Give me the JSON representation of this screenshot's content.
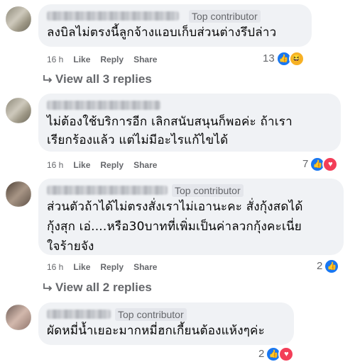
{
  "comments": [
    {
      "badge": "Top contributor",
      "text_lines": [
        "ลงบิลไม่ตรงนี้ลูกจ้างแอบเก็บส่วนต่างรึปล่าว"
      ],
      "time": "16 h",
      "like": "Like",
      "reply": "Reply",
      "share": "Share",
      "reaction_count": "13",
      "reactions": [
        "like-icon",
        "haha-icon"
      ]
    },
    {
      "badge": "",
      "text_lines": [
        "ไม่ต้องใช้บริการอีก เลิกสนับสนุนก็พอค่ะ ถ้าเรา",
        "เรียกร้องแล้ว แต่ไม่มีอะไรแก้ไขได้"
      ],
      "time": "16 h",
      "like": "Like",
      "reply": "Reply",
      "share": "Share",
      "reaction_count": "7",
      "reactions": [
        "like-icon",
        "heart-icon"
      ]
    },
    {
      "badge": "Top contributor",
      "text_lines": [
        "ส่วนตัวถ้าได้ไม่ตรงสั่งเราไม่เอานะคะ สั่งกุ้งสดได้",
        "กุ้งสุก เอ่....หรือ30บาทที่เพิ่มเป็นค่าลวกกุ้งคะเนี่ย",
        "ใจร้ายจัง"
      ],
      "time": "16 h",
      "like": "Like",
      "reply": "Reply",
      "share": "Share",
      "reaction_count": "2",
      "reactions": [
        "like-icon"
      ]
    },
    {
      "badge": "Top contributor",
      "text_lines": [
        "ผัดหมี่น้ำเยอะมากหมี่ฮกเกี้ยนต้องแห้งๆค่ะ"
      ],
      "time": "",
      "like": "",
      "reply": "",
      "share": "",
      "reaction_count": "2",
      "reactions": [
        "like-icon",
        "heart-icon"
      ]
    }
  ],
  "view_replies": [
    "View all 3 replies",
    "View all 2 replies"
  ],
  "colors": {
    "bubble": "#f0f2f5",
    "meta": "#65676b",
    "like": "#1877f2",
    "heart": "#f33e58",
    "haha": "#f7b125"
  }
}
